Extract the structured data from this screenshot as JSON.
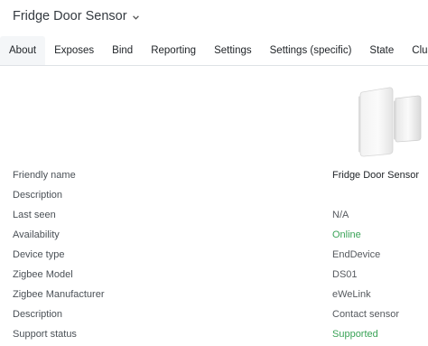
{
  "header": {
    "title": "Fridge Door Sensor"
  },
  "tabs": [
    {
      "label": "About"
    },
    {
      "label": "Exposes"
    },
    {
      "label": "Bind"
    },
    {
      "label": "Reporting"
    },
    {
      "label": "Settings"
    },
    {
      "label": "Settings (specific)"
    },
    {
      "label": "State"
    },
    {
      "label": "Clusters"
    }
  ],
  "about": {
    "rows": [
      {
        "label": "Friendly name",
        "value": "Fridge Door Sensor"
      },
      {
        "label": "Description",
        "value": ""
      },
      {
        "label": "Last seen",
        "value": "N/A"
      },
      {
        "label": "Availability",
        "value": "Online"
      },
      {
        "label": "Device type",
        "value": "EndDevice"
      },
      {
        "label": "Zigbee Model",
        "value": "DS01"
      },
      {
        "label": "Zigbee Manufacturer",
        "value": "eWeLink"
      },
      {
        "label": "Description",
        "value": "Contact sensor"
      },
      {
        "label": "Support status",
        "value": "Supported"
      }
    ]
  },
  "colors": {
    "status_green": "#3aa357",
    "active_tab_bg": "#f4f6f8"
  },
  "icons": {
    "title_dropdown": "chevron-down-icon"
  }
}
